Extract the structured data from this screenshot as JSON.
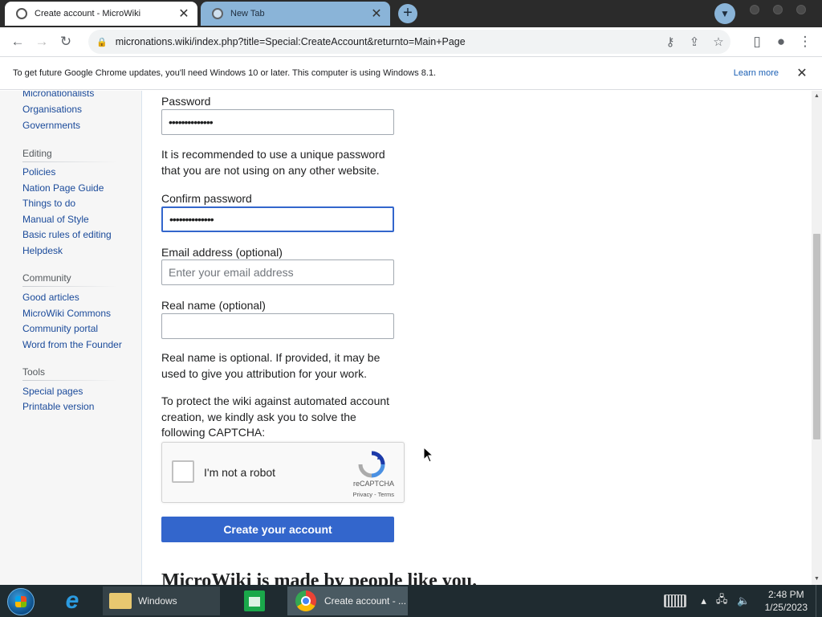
{
  "browser": {
    "tabs": [
      {
        "title": "Create account - MicroWiki",
        "close_icon": "close-icon"
      },
      {
        "title": "New Tab",
        "close_icon": "close-icon"
      }
    ],
    "new_tab_icon": "+",
    "url": "micronations.wiki/index.php?title=Special:CreateAccount&returnto=Main+Page"
  },
  "infobar": {
    "message": "To get future Google Chrome updates, you'll need Windows 10 or later. This computer is using Windows 8.1.",
    "learn_more": "Learn more"
  },
  "sidebar": {
    "top_links": [
      "Micronationalists",
      "Organisations",
      "Governments"
    ],
    "sections": [
      {
        "heading": "Editing",
        "links": [
          "Policies",
          "Nation Page Guide",
          "Things to do",
          "Manual of Style",
          "Basic rules of editing",
          "Helpdesk"
        ]
      },
      {
        "heading": "Community",
        "links": [
          "Good articles",
          "MicroWiki Commons",
          "Community portal",
          "Word from the Founder"
        ]
      },
      {
        "heading": "Tools",
        "links": [
          "Special pages",
          "Printable version"
        ]
      }
    ]
  },
  "form": {
    "password_label": "Password",
    "password_value": "••••••••••••••",
    "password_help": "It is recommended to use a unique password that you are not using on any other website.",
    "confirm_label": "Confirm password",
    "confirm_value": "••••••••••••••",
    "email_label": "Email address (optional)",
    "email_placeholder": "Enter your email address",
    "realname_label": "Real name (optional)",
    "realname_help": "Real name is optional. If provided, it may be used to give you attribution for your work.",
    "captcha_help": "To protect the wiki against automated account creation, we kindly ask you to solve the following CAPTCHA:",
    "captcha": {
      "label": "I'm not a robot",
      "brand": "reCAPTCHA",
      "links": "Privacy - Terms"
    },
    "submit_label": "Create your account",
    "tagline": "MicroWiki is made by people like you."
  },
  "taskbar": {
    "windows_label": "Windows",
    "chrome_label": "Create account - ...",
    "time": "2:48 PM",
    "date": "1/25/2023"
  }
}
